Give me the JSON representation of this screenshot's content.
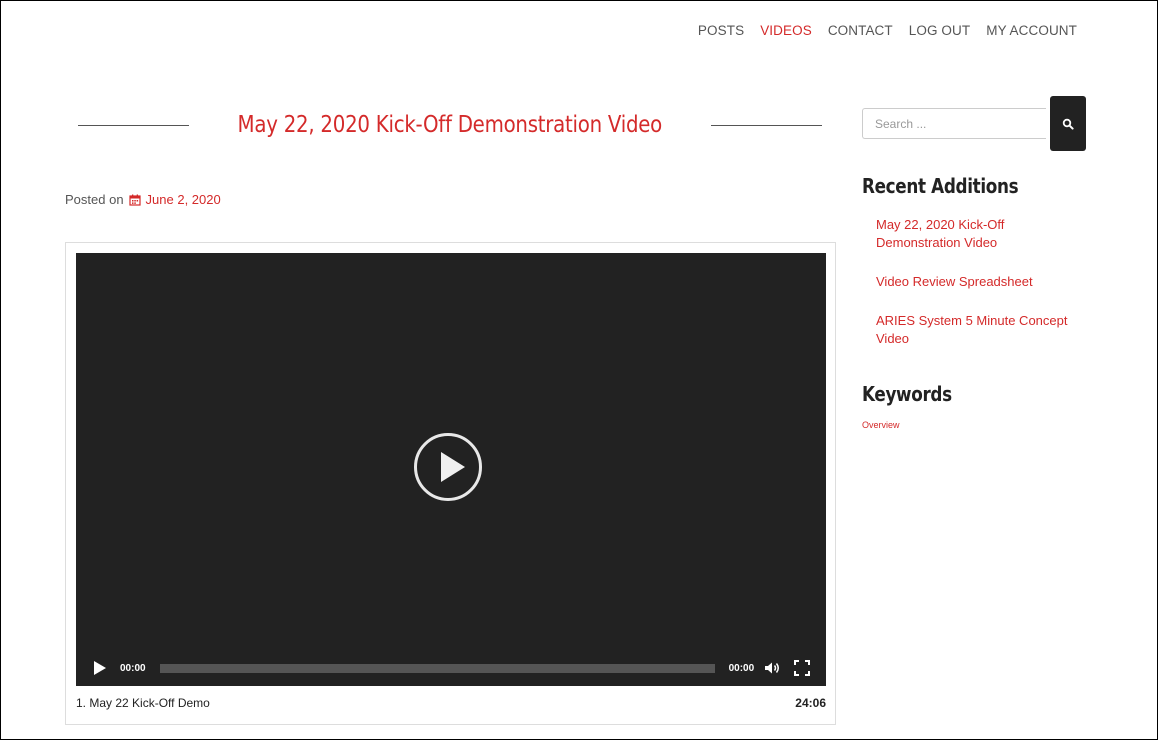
{
  "nav": {
    "items": [
      {
        "label": "POSTS"
      },
      {
        "label": "VIDEOS"
      },
      {
        "label": "CONTACT"
      },
      {
        "label": "LOG OUT"
      },
      {
        "label": "MY ACCOUNT"
      }
    ],
    "active": "VIDEOS"
  },
  "post": {
    "title": "May 22, 2020 Kick-Off Demonstration Video",
    "posted_prefix": "Posted on",
    "date": "June 2, 2020"
  },
  "player": {
    "current_time": "00:00",
    "duration_time": "00:00",
    "progress": 0,
    "track_title": "1. May 22 Kick-Off Demo",
    "track_duration": "24:06"
  },
  "sidebar": {
    "search_placeholder": "Search ...",
    "recent_heading": "Recent Additions",
    "recent_items": [
      {
        "label": "May 22, 2020 Kick-Off Demonstration Video"
      },
      {
        "label": "Video Review Spreadsheet"
      },
      {
        "label": "ARIES System 5 Minute Concept Video"
      }
    ],
    "keywords_heading": "Keywords",
    "keywords": [
      {
        "label": "Overview"
      }
    ]
  },
  "colors": {
    "accent": "#d42a2a",
    "player_bg": "#222222",
    "text": "#555555"
  },
  "icons": {
    "date": "calendar-icon",
    "search": "search-icon",
    "play": "play-icon",
    "volume": "volume-icon",
    "fullscreen": "fullscreen-icon"
  }
}
